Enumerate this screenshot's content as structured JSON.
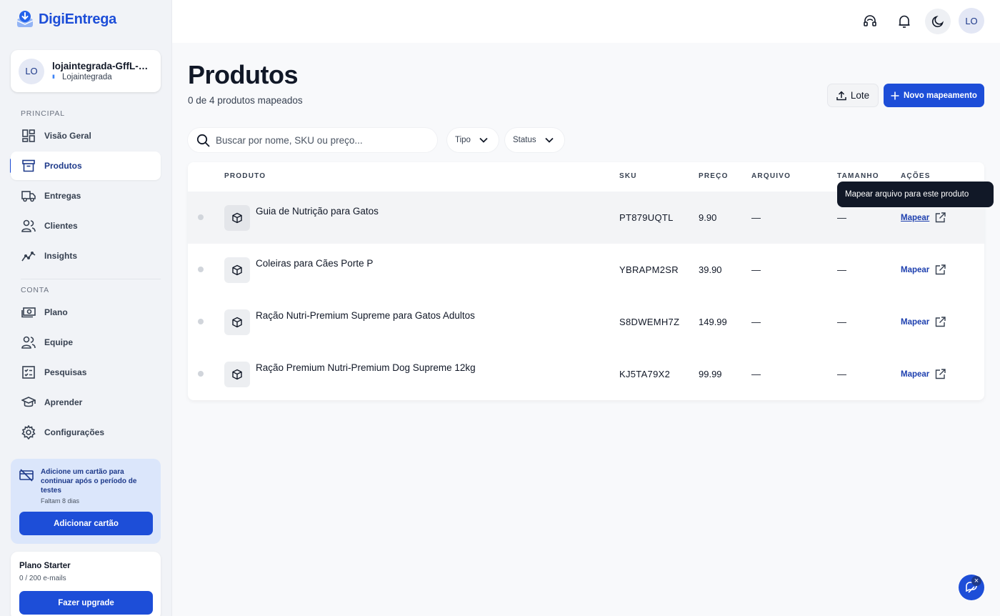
{
  "brand": {
    "name": "DigiEntrega",
    "accent": "#1d4ed8"
  },
  "account": {
    "initials": "LO",
    "name": "lojaintegrada-GffL-K...",
    "platform": "Lojaintegrada"
  },
  "sidebar": {
    "section_main": "PRINCIPAL",
    "section_account": "CONTA",
    "items": [
      {
        "label": "Visão Geral",
        "icon": "dashboard-icon"
      },
      {
        "label": "Produtos",
        "icon": "box-icon",
        "active": true
      },
      {
        "label": "Entregas",
        "icon": "truck-icon"
      },
      {
        "label": "Clientes",
        "icon": "users-icon"
      },
      {
        "label": "Insights",
        "icon": "chart-line-icon"
      }
    ],
    "account_items": [
      {
        "label": "Plano",
        "icon": "money-icon"
      },
      {
        "label": "Equipe",
        "icon": "team-icon"
      },
      {
        "label": "Pesquisas",
        "icon": "checklist-icon"
      },
      {
        "label": "Aprender",
        "icon": "graduation-cap-icon"
      },
      {
        "label": "Configurações",
        "icon": "gear-icon"
      }
    ]
  },
  "trial": {
    "text": "Adicione um cartão para continuar após o período de testes",
    "remaining": "Faltam 8 dias",
    "button": "Adicionar cartão"
  },
  "plan": {
    "title": "Plano Starter",
    "usage": "0 / 200 e-mails",
    "button": "Fazer upgrade"
  },
  "topbar": {
    "user_initials": "LO"
  },
  "page": {
    "title": "Produtos",
    "subtitle": "0 de 4 produtos mapeados",
    "batch_button": "Lote",
    "new_button": "Novo mapeamento"
  },
  "filters": {
    "search_placeholder": "Buscar por nome, SKU ou preço...",
    "type_label": "Tipo",
    "status_label": "Status"
  },
  "table": {
    "headers": {
      "product": "PRODUTO",
      "sku": "SKU",
      "price": "PREÇO",
      "file": "ARQUIVO",
      "size": "TAMANHO",
      "actions": "AÇÕES"
    },
    "rows": [
      {
        "name": "Guia de Nutrição para Gatos",
        "sku": "PT879UQTL",
        "price": "9.90",
        "file": "—",
        "size": "—",
        "action": "Mapear"
      },
      {
        "name": "Coleiras para Cães Porte P",
        "sku": "YBRAPM2SR",
        "price": "39.90",
        "file": "—",
        "size": "—",
        "action": "Mapear"
      },
      {
        "name": "Ração Nutri-Premium Supreme para Gatos Adultos",
        "sku": "S8DWEMH7Z",
        "price": "149.99",
        "file": "—",
        "size": "—",
        "action": "Mapear"
      },
      {
        "name": "Ração Premium Nutri-Premium Dog Supreme 12kg",
        "sku": "KJ5TA79X2",
        "price": "99.99",
        "file": "—",
        "size": "—",
        "action": "Mapear"
      }
    ]
  },
  "tooltip": {
    "text": "Mapear arquivo para este produto"
  }
}
